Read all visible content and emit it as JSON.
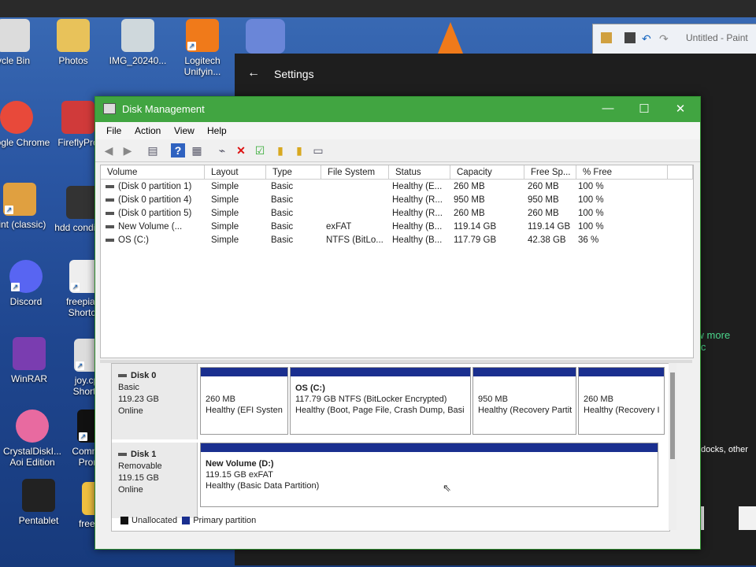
{
  "desktop": {
    "icons": [
      {
        "label": "ycle Bin",
        "color": "#dcdcdc"
      },
      {
        "label": "Photos",
        "color": "#e8c25a"
      },
      {
        "label": "IMG_20240...",
        "color": "#cfd8dc"
      },
      {
        "label": "Logitech Unifyin...",
        "color": "#f07a1a"
      },
      {
        "label": "Google Chrome",
        "color": "#e8493a"
      },
      {
        "label": "FireflyPro",
        "color": "#d03a3a"
      },
      {
        "label": "aint (classic)",
        "color": "#e0a040"
      },
      {
        "label": "hdd condition",
        "color": "#333333"
      },
      {
        "label": "Discord",
        "color": "#5865f2"
      },
      {
        "label": "freepiano Shortcut",
        "color": "#eeeeee"
      },
      {
        "label": "WinRAR",
        "color": "#7a3db0"
      },
      {
        "label": "joy.cpl - Shortcut",
        "color": "#dddddd"
      },
      {
        "label": "CrystalDiskI... Aoi Edition",
        "color": "#e86aa0"
      },
      {
        "label": "Command Prompt",
        "color": "#111111"
      },
      {
        "label": "Pentablet",
        "color": "#222222"
      },
      {
        "label": "freepiano",
        "color": "#f0c040"
      }
    ]
  },
  "paint": {
    "title": "Untitled - Paint"
  },
  "settings": {
    "title": "Settings",
    "back_icon": "arrow-left-icon",
    "view_more": "View more devic",
    "docks_text": "s and docks, other de"
  },
  "window": {
    "title": "Disk Management",
    "menu": [
      "File",
      "Action",
      "View",
      "Help"
    ],
    "toolbar_icons": [
      "back-icon",
      "forward-icon",
      "console-icon",
      "help-icon",
      "properties-icon",
      "connect-icon",
      "delete-icon",
      "check-icon",
      "import-icon",
      "export-icon",
      "view-icon"
    ]
  },
  "volume_list": {
    "headers": [
      "Volume",
      "Layout",
      "Type",
      "File System",
      "Status",
      "Capacity",
      "Free Sp...",
      "% Free"
    ],
    "rows": [
      {
        "volume": "(Disk 0 partition 1)",
        "layout": "Simple",
        "type": "Basic",
        "fs": "",
        "status": "Healthy (E...",
        "capacity": "260 MB",
        "free": "260 MB",
        "pct": "100 %"
      },
      {
        "volume": "(Disk 0 partition 4)",
        "layout": "Simple",
        "type": "Basic",
        "fs": "",
        "status": "Healthy (R...",
        "capacity": "950 MB",
        "free": "950 MB",
        "pct": "100 %"
      },
      {
        "volume": "(Disk 0 partition 5)",
        "layout": "Simple",
        "type": "Basic",
        "fs": "",
        "status": "Healthy (R...",
        "capacity": "260 MB",
        "free": "260 MB",
        "pct": "100 %"
      },
      {
        "volume": "New Volume (...",
        "layout": "Simple",
        "type": "Basic",
        "fs": "exFAT",
        "status": "Healthy (B...",
        "capacity": "119.14 GB",
        "free": "119.14 GB",
        "pct": "100 %"
      },
      {
        "volume": "OS (C:)",
        "layout": "Simple",
        "type": "Basic",
        "fs": "NTFS (BitLo...",
        "status": "Healthy (B...",
        "capacity": "117.79 GB",
        "free": "42.38 GB",
        "pct": "36 %"
      }
    ]
  },
  "disks": [
    {
      "name": "Disk 0",
      "kind": "Basic",
      "size": "119.23 GB",
      "state": "Online",
      "partitions": [
        {
          "name": "",
          "line1": "260 MB",
          "line2": "Healthy (EFI Systen"
        },
        {
          "name": "OS  (C:)",
          "line1": "117.79 GB NTFS (BitLocker Encrypted)",
          "line2": "Healthy (Boot, Page File, Crash Dump, Basi"
        },
        {
          "name": "",
          "line1": "950 MB",
          "line2": "Healthy (Recovery Partit"
        },
        {
          "name": "",
          "line1": "260 MB",
          "line2": "Healthy (Recovery I"
        }
      ]
    },
    {
      "name": "Disk 1",
      "kind": "Removable",
      "size": "119.15 GB",
      "state": "Online",
      "partitions": [
        {
          "name": "New Volume  (D:)",
          "line1": "119.15 GB exFAT",
          "line2": "Healthy (Basic Data Partition)"
        }
      ]
    }
  ],
  "legend": {
    "unallocated": "Unallocated",
    "primary": "Primary partition",
    "unallocated_color": "#111111",
    "primary_color": "#1a2f8f"
  },
  "accent": "#41a541"
}
